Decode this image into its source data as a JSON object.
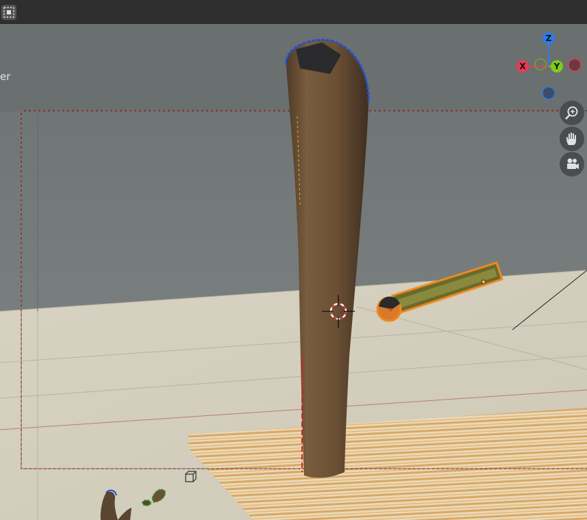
{
  "header": {
    "select_mode_icon": "box-select-icon"
  },
  "viewport": {
    "partial_label": "er",
    "gizmo": {
      "axes": [
        {
          "label": "Z",
          "color": "#2e7ce6"
        },
        {
          "label": "X",
          "color": "#e53c56"
        },
        {
          "label": "Y",
          "color": "#7fcb1a"
        }
      ]
    },
    "nav_buttons": [
      {
        "name": "zoom",
        "icon": "zoom-icon"
      },
      {
        "name": "pan",
        "icon": "hand-icon"
      },
      {
        "name": "camera",
        "icon": "camera-icon"
      }
    ],
    "overlay_icon": "wireframe-cube-icon",
    "colors": {
      "selection_outline": "#f08a1c",
      "camera_frame": "#d05050",
      "floor": "#d6d1c1",
      "wall": "#6f7575"
    }
  }
}
